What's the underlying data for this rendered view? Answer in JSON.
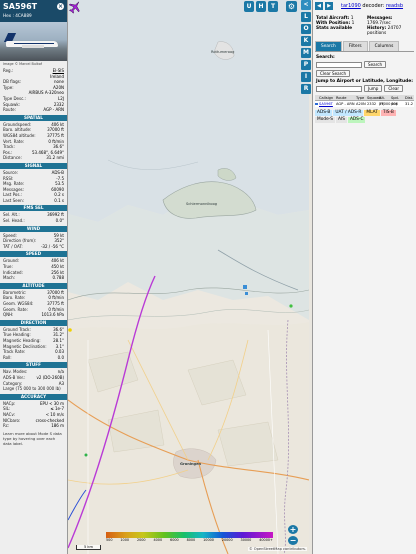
{
  "panel": {
    "callsign": "SA596T",
    "hex_label": "Hex :",
    "hex": "4CA889",
    "photo_credit": "Image © Marcel Bulkof",
    "rows_top": [
      {
        "k": "Reg.:",
        "v": "EI-SIS"
      },
      {
        "k": "",
        "v": "Ireland"
      },
      {
        "k": "DB flags:",
        "v": "none"
      },
      {
        "k": "Type:",
        "v": "A20N"
      },
      {
        "k": "",
        "v": "AIRBUS A-320neo"
      },
      {
        "k": "Type Desc.:",
        "v": "L2J"
      },
      {
        "k": "Squawk:",
        "v": "2332"
      },
      {
        "k": "Route:",
        "v": "AGP - ARN"
      }
    ],
    "sections": [
      {
        "title": "SPATIAL",
        "rows": [
          {
            "k": "Groundspeed:",
            "v": "406 kt"
          },
          {
            "k": "Baro. altitude:",
            "v": "37000 ft"
          },
          {
            "k": "WGS84 altitude:",
            "v": "37775 ft"
          },
          {
            "k": "Vert. Rate:",
            "v": "0 ft/min"
          },
          {
            "k": "Track:",
            "v": "36.6°"
          },
          {
            "k": "Pos.:",
            "v": "53.468°, 6.649°"
          },
          {
            "k": "Distance:",
            "v": "31.2 nmi"
          }
        ]
      },
      {
        "title": "SIGNAL",
        "rows": [
          {
            "k": "Source:",
            "v": "ADS-B"
          },
          {
            "k": "RSSI:",
            "v": "-7.5"
          },
          {
            "k": "Msg. Rate:",
            "v": "53.5"
          },
          {
            "k": "Messages:",
            "v": "60090"
          },
          {
            "k": "Last Pos.:",
            "v": "0.2 s"
          },
          {
            "k": "Last Seen:",
            "v": "0.1 s"
          }
        ]
      },
      {
        "title": "FMS SEL",
        "rows": [
          {
            "k": "Sel. Alt.:",
            "v": "36992 ft"
          },
          {
            "k": "Sel. Head.:",
            "v": "0.0°"
          }
        ]
      },
      {
        "title": "WIND",
        "rows": [
          {
            "k": "Speed:",
            "v": "59 kt"
          },
          {
            "k": "Direction (from):",
            "v": "352°"
          },
          {
            "k": "TAT / OAT:",
            "v": "-32 / -56 °C"
          }
        ]
      },
      {
        "title": "SPEED",
        "rows": [
          {
            "k": "Ground:",
            "v": "406 kt"
          },
          {
            "k": "True:",
            "v": "450 kt"
          },
          {
            "k": "Indicated:",
            "v": "256 kt"
          },
          {
            "k": "Mach:",
            "v": "0.788"
          }
        ]
      },
      {
        "title": "ALTITUDE",
        "rows": [
          {
            "k": "Barometric:",
            "v": "37000 ft"
          },
          {
            "k": "Baro. Rate:",
            "v": "0 ft/min"
          },
          {
            "k": "Geom. WGS84:",
            "v": "37775 ft"
          },
          {
            "k": "Geom. Rate:",
            "v": "0 ft/min"
          },
          {
            "k": "QNH:",
            "v": "1013.6 hPa"
          }
        ]
      },
      {
        "title": "DIRECTION",
        "rows": [
          {
            "k": "Ground Track:",
            "v": "36.6°"
          },
          {
            "k": "True Heading:",
            "v": "31.2°"
          },
          {
            "k": "Magnetic Heading:",
            "v": "28.1°"
          },
          {
            "k": "Magnetic Declination:",
            "v": "3.1°"
          },
          {
            "k": "Track Rate:",
            "v": "0.03"
          },
          {
            "k": "Roll:",
            "v": "0.0"
          }
        ]
      },
      {
        "title": "STUFF",
        "rows": [
          {
            "k": "Nav. Modes:",
            "v": "n/a"
          },
          {
            "k": "ADS-B Ver.:",
            "v": "v2 (DO-260B)"
          },
          {
            "k": "Category:",
            "v": "A3"
          },
          {
            "k": "Large (75 000 to 300 000 lb)",
            "v": ""
          }
        ]
      },
      {
        "title": "ACCURACY",
        "rows": [
          {
            "k": "NACp:",
            "v": "EPU < 30 m"
          },
          {
            "k": "SIL:",
            "v": "≤ 1e-7"
          },
          {
            "k": "NACv:",
            "v": "< 10 m/s"
          },
          {
            "k": "NICbaro:",
            "v": "cross-checked"
          },
          {
            "k": "Rc:",
            "v": "186 m"
          }
        ]
      }
    ],
    "footer": "Learn more about Mode S data type by hovering over each data label."
  },
  "map": {
    "top_buttons": [
      "U",
      "H",
      "T"
    ],
    "gear_icon": "gear-icon",
    "zoom_in": "+",
    "zoom_out": "−",
    "scale_label": "5 km",
    "altitude_labels": [
      "500",
      "1000",
      "2000",
      "4000",
      "6000",
      "8000",
      "10000",
      "20000",
      "30000",
      "40000+"
    ],
    "attribution": "© OpenStreetMap contributors.",
    "place_labels": {
      "island": "Schiermonnikoog",
      "city": "Groningen",
      "island2": "Rottumeroog"
    }
  },
  "strip": {
    "buttons": [
      "<",
      "L",
      "O",
      "K",
      "M",
      "P",
      "I",
      "R"
    ]
  },
  "right": {
    "nav_left": "◀",
    "nav_right": "▶",
    "brand_link": "tar1090",
    "brand_text": "decoder:",
    "brand_status": "readsb",
    "stats": {
      "total_aircraft_label": "Total Aircraft:",
      "total_aircraft": "1",
      "with_position_label": "With Position:",
      "with_position": "1",
      "stats_available": "Stats available",
      "messages_label": "Messages:",
      "messages_rate": "1769.7/sec",
      "history_label": "History:",
      "history": "24707 positions"
    },
    "tabs": [
      "Search",
      "Filters",
      "Columns"
    ],
    "search_label": "Search:",
    "search_button": "Search",
    "clear_search_button": "Clear Search",
    "jump_label": "Jump to Airport or Latitude, Longitude:",
    "jump_button": "Jump",
    "clear_button": "Clear",
    "table_headers": [
      "",
      "Callsign",
      "Route",
      "Type",
      "Squawk",
      "Alt. (ft)",
      "Spd. (kt)",
      "Dist."
    ],
    "table_rows": [
      [
        "",
        "SA596T",
        "AGP - ARN",
        "A20N",
        "2332",
        "37000",
        "406",
        "31.2"
      ]
    ],
    "legend": [
      {
        "label": "ADS-B",
        "color": "#c3e8ff"
      },
      {
        "label": "UAT / ADS-R",
        "color": "#c3e8ff"
      },
      {
        "label": "MLAT",
        "color": "#ffd66b"
      },
      {
        "label": "TIS-B",
        "color": "#ffb3b3"
      },
      {
        "label": "Mode-S",
        "color": "#e4e4e4"
      },
      {
        "label": "AIS",
        "color": "#e4e4e4"
      },
      {
        "label": "ADS-C",
        "color": "#bdf5bd"
      }
    ]
  }
}
